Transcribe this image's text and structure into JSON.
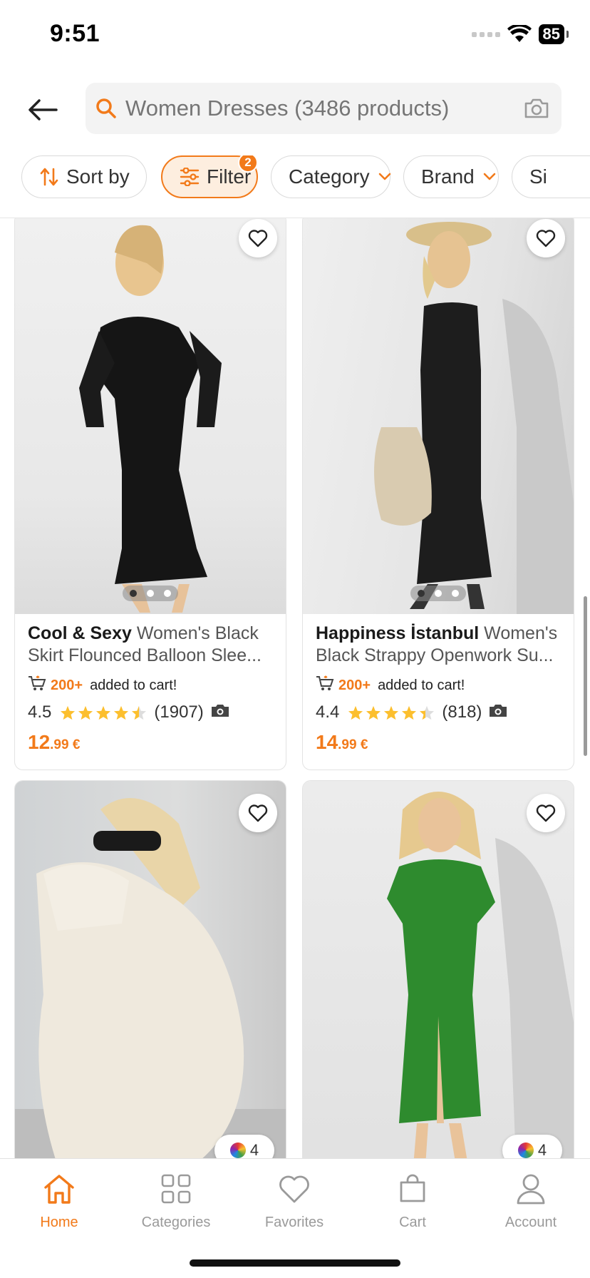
{
  "status_bar": {
    "time": "9:51",
    "battery": "85"
  },
  "search": {
    "placeholder": "Women Dresses (3486 products)"
  },
  "chips": [
    {
      "label": "Sort by",
      "icon": "sort-arrows-icon"
    },
    {
      "label": "Filter",
      "icon": "sliders-icon",
      "badge": "2"
    },
    {
      "label": "Category",
      "icon": "chevron-down-icon"
    },
    {
      "label": "Brand",
      "icon": "chevron-down-icon"
    },
    {
      "label": "Si"
    }
  ],
  "products": [
    {
      "brand": "Cool & Sexy",
      "name": "Women's Black Skirt Flounced Balloon Slee...",
      "cart_count": "200+",
      "cart_text": "added to cart!",
      "rating": "4.5",
      "reviews": "(1907)",
      "price_int": "12",
      "price_dec": ".99 €",
      "images": 3,
      "active_image": 1
    },
    {
      "brand": "Happiness İstanbul",
      "name": "Women's Black Strappy Openwork Su...",
      "cart_count": "200+",
      "cart_text": "added to cart!",
      "rating": "4.4",
      "reviews": "(818)",
      "price_int": "14",
      "price_dec": ".99 €",
      "images": 3,
      "active_image": 1
    },
    {
      "swatch_count": "4"
    },
    {
      "swatch_count": "4"
    }
  ],
  "nav": [
    {
      "label": "Home",
      "icon": "home-icon",
      "active": true
    },
    {
      "label": "Categories",
      "icon": "grid-icon"
    },
    {
      "label": "Favorites",
      "icon": "heart-icon"
    },
    {
      "label": "Cart",
      "icon": "bag-icon"
    },
    {
      "label": "Account",
      "icon": "user-icon"
    }
  ],
  "colors": {
    "accent": "#f27a1a",
    "muted": "#9a9a9a"
  }
}
